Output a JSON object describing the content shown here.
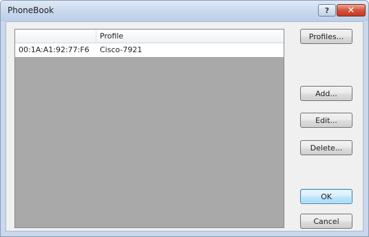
{
  "window": {
    "title": "PhoneBook",
    "help_glyph": "?",
    "close_glyph": "✕"
  },
  "table": {
    "columns": [
      "",
      "Profile"
    ],
    "rows": [
      [
        "00:1A:A1:92:77:F6",
        "Cisco-7921"
      ]
    ]
  },
  "buttons": {
    "profiles": "Profiles...",
    "add": "Add...",
    "edit": "Edit...",
    "delete": "Delete...",
    "ok": "OK",
    "cancel": "Cancel"
  }
}
